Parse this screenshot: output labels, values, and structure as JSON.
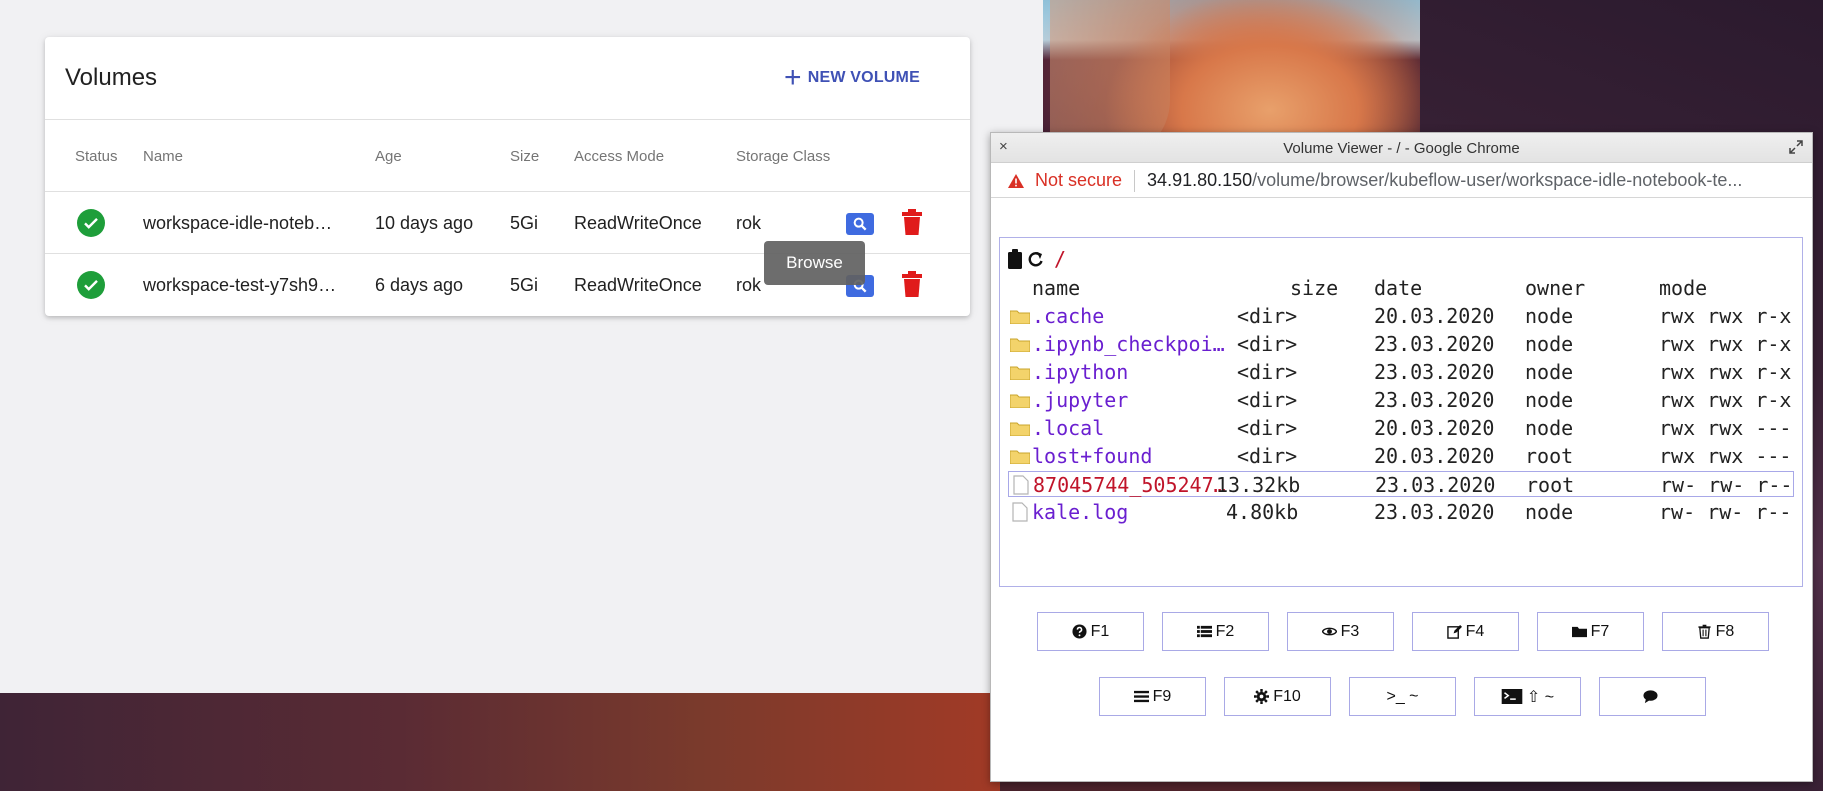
{
  "volumes": {
    "title": "Volumes",
    "new_button": "NEW VOLUME",
    "columns": {
      "status": "Status",
      "name": "Name",
      "age": "Age",
      "size": "Size",
      "access_mode": "Access Mode",
      "storage_class": "Storage Class"
    },
    "rows": [
      {
        "status": "ok",
        "name": "workspace-idle-noteb…",
        "age": "10 days ago",
        "size": "5Gi",
        "access_mode": "ReadWriteOnce",
        "storage_class": "rok"
      },
      {
        "status": "ok",
        "name": "workspace-test-y7sh9…",
        "age": "6 days ago",
        "size": "5Gi",
        "access_mode": "ReadWriteOnce",
        "storage_class": "rok"
      }
    ],
    "tooltip": "Browse"
  },
  "chrome": {
    "close": "×",
    "title": "Volume Viewer - / - Google Chrome",
    "not_secure": "Not secure",
    "url_host": "34.91.80.150",
    "url_path": "/volume/browser/kubeflow-user/workspace-idle-notebook-te..."
  },
  "browser": {
    "path": "/",
    "columns": {
      "name": "name",
      "size": "size",
      "date": "date",
      "owner": "owner",
      "mode": "mode"
    },
    "entries": [
      {
        "type": "dir",
        "name": ".cache",
        "size": "<dir>",
        "date": "20.03.2020",
        "owner": "node",
        "mode": "rwx rwx r-x"
      },
      {
        "type": "dir",
        "name": ".ipynb_checkpoi…",
        "size": "<dir>",
        "date": "23.03.2020",
        "owner": "node",
        "mode": "rwx rwx r-x"
      },
      {
        "type": "dir",
        "name": ".ipython",
        "size": "<dir>",
        "date": "23.03.2020",
        "owner": "node",
        "mode": "rwx rwx r-x"
      },
      {
        "type": "dir",
        "name": ".jupyter",
        "size": "<dir>",
        "date": "23.03.2020",
        "owner": "node",
        "mode": "rwx rwx r-x"
      },
      {
        "type": "dir",
        "name": ".local",
        "size": "<dir>",
        "date": "20.03.2020",
        "owner": "node",
        "mode": "rwx rwx ---"
      },
      {
        "type": "dir",
        "name": "lost+found",
        "size": "<dir>",
        "date": "20.03.2020",
        "owner": "root",
        "mode": "rwx rwx ---"
      },
      {
        "type": "file",
        "name": "87045744_505247…",
        "size": "13.32kb",
        "date": "23.03.2020",
        "owner": "root",
        "mode": "rw- rw- r--",
        "selected": true
      },
      {
        "type": "file",
        "name": "kale.log",
        "size": "4.80kb",
        "date": "23.03.2020",
        "owner": "node",
        "mode": "rw- rw- r--"
      }
    ],
    "fkeys_row1": [
      {
        "icon": "help-icon",
        "label": "F1"
      },
      {
        "icon": "list-icon",
        "label": "F2"
      },
      {
        "icon": "eye-icon",
        "label": "F3"
      },
      {
        "icon": "edit-icon",
        "label": "F4"
      },
      {
        "icon": "folder-icon",
        "label": "F7"
      },
      {
        "icon": "trash-icon",
        "label": "F8"
      }
    ],
    "fkeys_row2": [
      {
        "icon": "menu-icon",
        "label": "F9"
      },
      {
        "icon": "gear-icon",
        "label": "F10"
      },
      {
        "icon": "",
        "label": ">_ ~"
      },
      {
        "icon": "terminal-icon",
        "label": "⇧ ~"
      },
      {
        "icon": "comment-icon",
        "label": ""
      }
    ]
  }
}
